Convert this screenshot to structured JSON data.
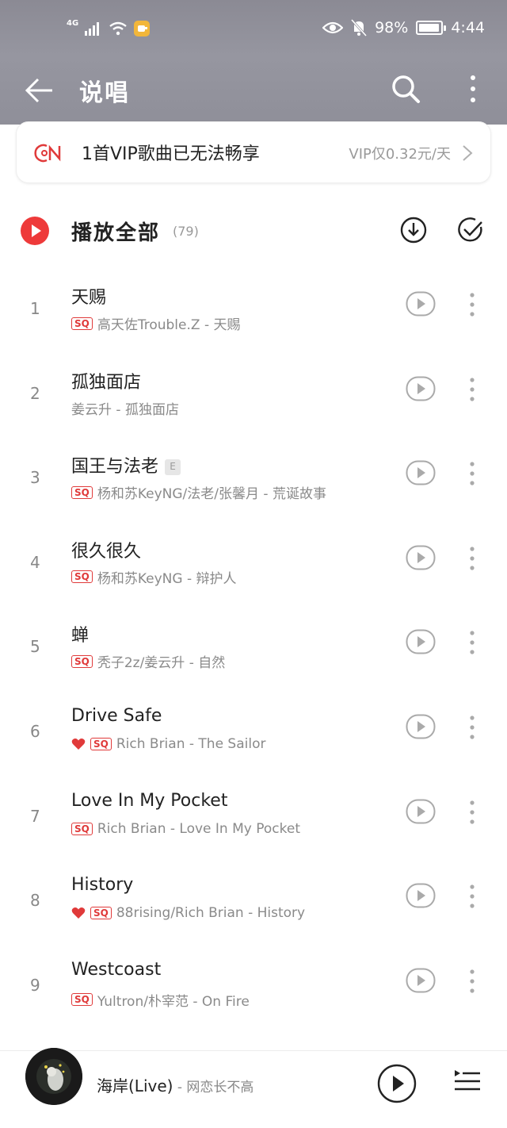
{
  "status_bar": {
    "network": "4G",
    "battery": "98%",
    "battery_level": 0.98,
    "time": "4:44",
    "icons": [
      "signal-icon",
      "wifi-icon",
      "app-notification-icon",
      "eye-icon",
      "mute-bell-icon",
      "battery-icon"
    ]
  },
  "nav": {
    "title": "说唱",
    "icons": [
      "back-arrow-icon",
      "search-icon",
      "more-vertical-icon"
    ]
  },
  "vip_banner": {
    "message": "1首VIP歌曲已无法畅享",
    "offer": "VIP仅0.32元/天",
    "icon": "vip-logo-icon"
  },
  "play_all": {
    "label": "播放全部",
    "count": "(79)"
  },
  "songs": [
    {
      "index": "1",
      "title": "天赐",
      "subtitle": "高天佐Trouble.Z - 天赐",
      "sq": "SQ"
    },
    {
      "index": "2",
      "title": "孤独面店",
      "subtitle": "姜云升 - 孤独面店",
      "sq": ""
    },
    {
      "index": "3",
      "title": "国王与法老",
      "explicit": "E",
      "subtitle": "杨和苏KeyNG/法老/张馨月 - 荒诞故事",
      "sq": "SQ"
    },
    {
      "index": "4",
      "title": "很久很久",
      "subtitle": "杨和苏KeyNG - 辩护人",
      "sq": "SQ"
    },
    {
      "index": "5",
      "title": "蝉",
      "subtitle": "秃子2z/姜云升 - 自然",
      "sq": "SQ"
    },
    {
      "index": "6",
      "title": "Drive Safe",
      "subtitle": "Rich Brian - The Sailor",
      "sq": "SQ",
      "liked": true
    },
    {
      "index": "7",
      "title": "Love In My Pocket",
      "subtitle": "Rich Brian - Love In My Pocket",
      "sq": "SQ"
    },
    {
      "index": "8",
      "title": "History",
      "subtitle": "88rising/Rich Brian - History",
      "sq": "SQ",
      "liked": true
    },
    {
      "index": "9",
      "title": "Westcoast",
      "subtitle": "Yultron/朴宰范 - On Fire",
      "sq": "SQ"
    }
  ],
  "mini_player": {
    "track": "海岸(Live)",
    "artist": " - 网恋长不高",
    "colors": {
      "accent": "#ee3a3a"
    }
  }
}
